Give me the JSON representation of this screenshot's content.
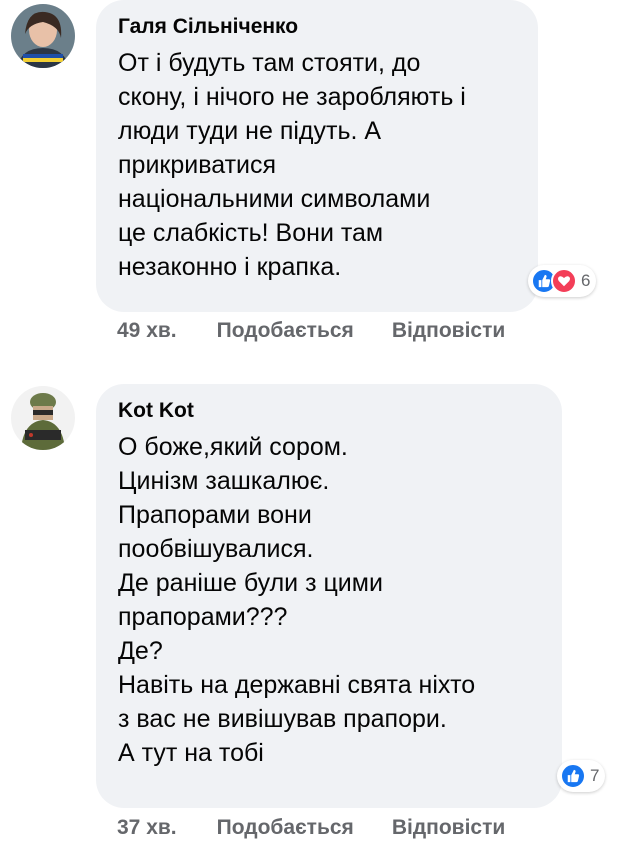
{
  "comments": [
    {
      "author": "Галя Сільніченко",
      "lines": [
        "От і будуть там стояти, до",
        "скону, і нічого не заробляють і",
        "люди туди не підуть. А",
        "прикриватися",
        "національними символами",
        "це слабкість!   Вони там",
        "незаконно і крапка."
      ],
      "reactions": {
        "types": [
          "like-icon",
          "love-icon"
        ],
        "count": "6"
      },
      "time": "49 хв.",
      "like_label": "Подобається",
      "reply_label": "Відповісти"
    },
    {
      "author": "Kot Kot",
      "lines": [
        "О боже,який сором.",
        "Цинізм зашкалює.",
        "Прапорами вони",
        "пообвішувалися.",
        "Де раніше були з цими",
        "прапорами???",
        "Де?",
        "Навіть на державні свята ніхто",
        "з вас не вивішував прапори.",
        "А тут на тобі"
      ],
      "reactions": {
        "types": [
          "like-icon"
        ],
        "count": "7"
      },
      "time": "37 хв.",
      "like_label": "Подобається",
      "reply_label": "Відповісти"
    }
  ],
  "colors": {
    "bubble": "#f0f2f5",
    "like": "#1877f2",
    "love": "#f33e58",
    "meta": "#65676b"
  }
}
